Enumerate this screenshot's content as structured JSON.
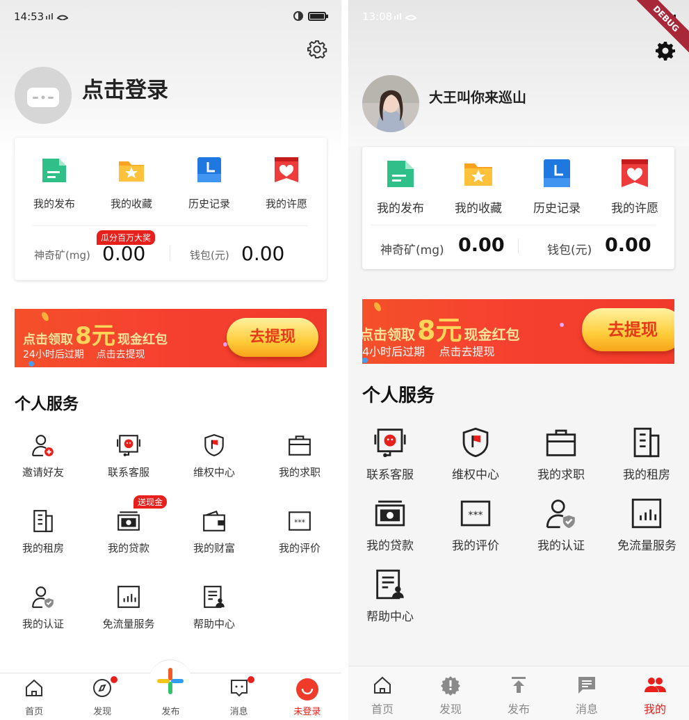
{
  "left": {
    "status": {
      "time": "14:53"
    },
    "header": {
      "login_label": "点击登录"
    },
    "quick": [
      {
        "label": "我的发布",
        "icon": "post-icon"
      },
      {
        "label": "我的收藏",
        "icon": "favorite-icon"
      },
      {
        "label": "历史记录",
        "icon": "history-icon"
      },
      {
        "label": "我的许愿",
        "icon": "wish-icon"
      }
    ],
    "stats": {
      "mineral_label": "神奇矿(mg)",
      "mineral_value": "0.00",
      "wallet_label": "钱包(元)",
      "wallet_value": "0.00",
      "promo_tag": "瓜分百万大奖"
    },
    "banner": {
      "line1_pre": "点击领取",
      "amount": "8元",
      "line1_post": "现金红包",
      "line2": "24小时后过期    点击去提现",
      "button": "去提现"
    },
    "section_title": "个人服务",
    "services": [
      {
        "label": "邀请好友",
        "icon": "invite-friend-icon"
      },
      {
        "label": "联系客服",
        "icon": "customer-service-icon"
      },
      {
        "label": "维权中心",
        "icon": "rights-shield-icon"
      },
      {
        "label": "我的求职",
        "icon": "briefcase-icon"
      },
      {
        "label": "我的租房",
        "icon": "building-icon"
      },
      {
        "label": "我的贷款",
        "icon": "cash-icon"
      },
      {
        "label": "我的财富",
        "icon": "wallet-icon"
      },
      {
        "label": "我的评价",
        "icon": "rating-icon"
      },
      {
        "label": "我的认证",
        "icon": "verified-user-icon"
      },
      {
        "label": "免流量服务",
        "icon": "chart-icon"
      },
      {
        "label": "帮助中心",
        "icon": "help-doc-icon"
      }
    ],
    "loan_tag": "送现金",
    "tabs": [
      {
        "label": "首页",
        "icon": "home-icon"
      },
      {
        "label": "发现",
        "icon": "compass-icon"
      },
      {
        "label": "发布",
        "icon": "plus-icon"
      },
      {
        "label": "消息",
        "icon": "message-icon"
      },
      {
        "label": "未登录",
        "icon": "profile-icon"
      }
    ],
    "colors": {
      "accent": "#e8201c"
    }
  },
  "right": {
    "status": {
      "time": "13:08"
    },
    "debug_label": "DEBUG",
    "header": {
      "username": "大王叫你来巡山"
    },
    "quick": [
      {
        "label": "我的发布",
        "icon": "post-icon"
      },
      {
        "label": "我的收藏",
        "icon": "favorite-icon"
      },
      {
        "label": "历史记录",
        "icon": "history-icon"
      },
      {
        "label": "我的许愿",
        "icon": "wish-icon"
      }
    ],
    "stats": {
      "mineral_label": "神奇矿(mg)",
      "mineral_value": "0.00",
      "wallet_label": "钱包(元)",
      "wallet_value": "0.00"
    },
    "banner": {
      "line1_pre": "点击领取",
      "amount": "8元",
      "line1_post": "现金红包",
      "line2": "4小时后过期    点击去提现",
      "button": "去提现"
    },
    "section_title": "个人服务",
    "services": [
      {
        "label": "联系客服",
        "icon": "customer-service-icon"
      },
      {
        "label": "维权中心",
        "icon": "rights-shield-icon"
      },
      {
        "label": "我的求职",
        "icon": "briefcase-icon"
      },
      {
        "label": "我的租房",
        "icon": "building-icon"
      },
      {
        "label": "我的贷款",
        "icon": "cash-icon"
      },
      {
        "label": "我的评价",
        "icon": "rating-icon"
      },
      {
        "label": "我的认证",
        "icon": "verified-user-icon"
      },
      {
        "label": "免流量服务",
        "icon": "chart-icon"
      },
      {
        "label": "帮助中心",
        "icon": "help-doc-icon"
      }
    ],
    "tabs": [
      {
        "label": "首页",
        "icon": "home-icon"
      },
      {
        "label": "发现",
        "icon": "badge-icon"
      },
      {
        "label": "发布",
        "icon": "upload-icon"
      },
      {
        "label": "消息",
        "icon": "chat-icon"
      },
      {
        "label": "我的",
        "icon": "people-icon"
      }
    ],
    "colors": {
      "accent": "#e8201c"
    }
  }
}
